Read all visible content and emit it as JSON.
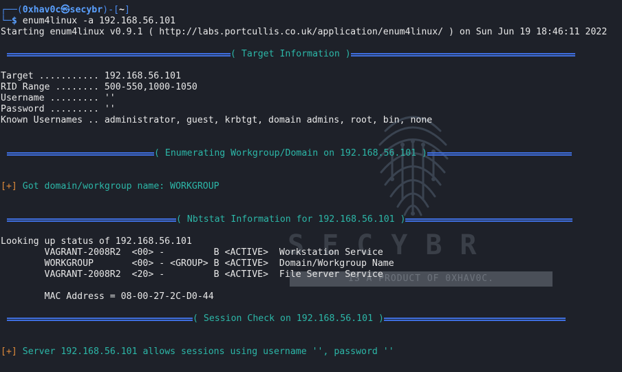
{
  "prompt": {
    "user": "0xhav0c",
    "symbol": "㉿",
    "host": "secybr",
    "dir": "~",
    "dollar": "$",
    "command": "enum4linux -a 192.168.56.101"
  },
  "starting_line": "Starting enum4linux v0.9.1 ( http://labs.portcullis.co.uk/application/enum4linux/ ) on Sun Jun 19 18:46:11 2022",
  "sections": {
    "target": "( Target Information )",
    "workgroup": "( Enumerating Workgroup/Domain on 192.168.56.101 )",
    "nbtstat": "( Nbtstat Information for 192.168.56.101 )",
    "session": "( Session Check on 192.168.56.101 )"
  },
  "target_info": [
    "Target ........... 192.168.56.101",
    "RID Range ........ 500-550,1000-1050",
    "Username ......... ''",
    "Password ......... ''",
    "Known Usernames .. administrator, guest, krbtgt, domain admins, root, bin, none"
  ],
  "workgroup_result": {
    "tag": "[+]",
    "text": "Got domain/workgroup name: WORKGROUP"
  },
  "nbtstat": {
    "header": "Looking up status of 192.168.56.101",
    "rows": [
      "        VAGRANT-2008R2  <00> -         B <ACTIVE>  Workstation Service",
      "        WORKGROUP       <00> - <GROUP> B <ACTIVE>  Domain/Workgroup Name",
      "        VAGRANT-2008R2  <20> -         B <ACTIVE>  File Server Service"
    ],
    "mac": "        MAC Address = 08-00-27-2C-D0-44"
  },
  "session_result": {
    "tag": "[+]",
    "text": "Server 192.168.56.101 allows sessions using username '', password ''"
  },
  "watermark": {
    "brand": "SECYBR",
    "tagline": "IS A PRODUCT OF 0XHAV0C."
  },
  "colors": {
    "background": "#1e2129",
    "prompt_blue": "#4a8cf0",
    "section_teal": "#2cb7a8",
    "tag_orange": "#e08b3a"
  }
}
